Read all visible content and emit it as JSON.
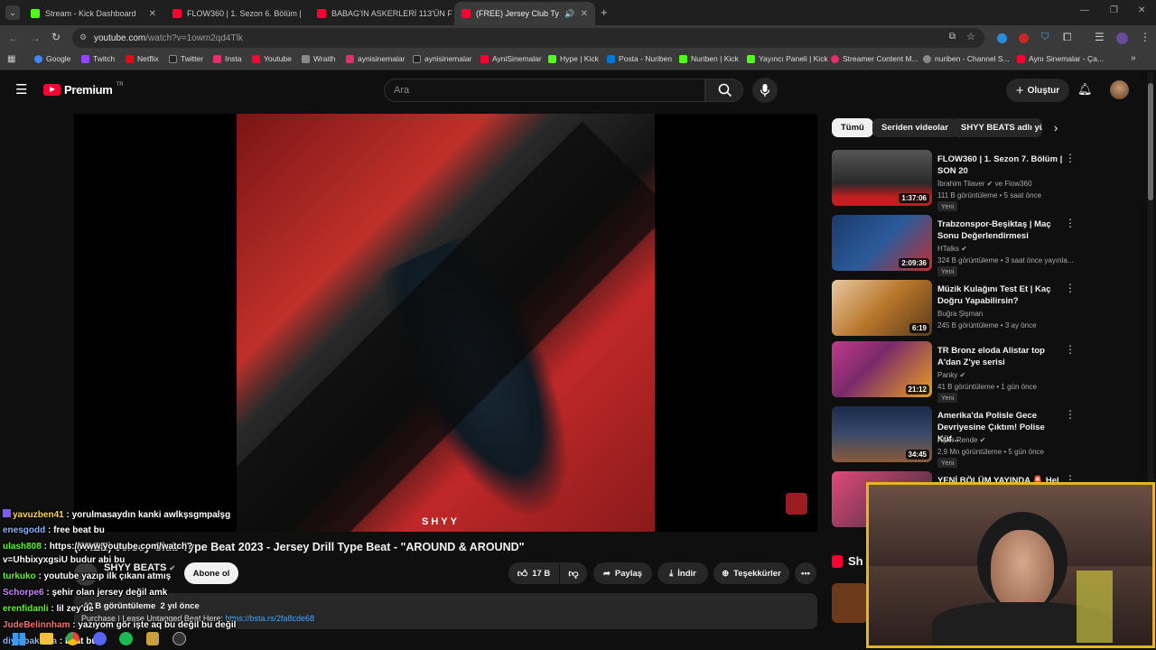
{
  "browser": {
    "tabs": [
      {
        "label": "Stream - Kick Dashboard",
        "favicon_color": "#53fc18"
      },
      {
        "label": "FLOW360 | 1. Sezon 6. Bölüm |",
        "favicon_color": "#ff0033"
      },
      {
        "label": "BABAG'IN ASKERLERİ 113'ÜN F",
        "favicon_color": "#ff0033"
      },
      {
        "label": "(FREE) Jersey Club Type Beat",
        "favicon_color": "#ff0033"
      }
    ],
    "new_tab": "+",
    "url_host": "youtube.com",
    "url_path": "/watch?v=1owm2qd4Tlk",
    "bookmarks": [
      {
        "label": "Google",
        "color": "#4285f4"
      },
      {
        "label": "Twitch",
        "color": "#9146ff"
      },
      {
        "label": "Netflix",
        "color": "#e50914"
      },
      {
        "label": "Twitter",
        "color": "#222222"
      },
      {
        "label": "Insta",
        "color": "#e1306c"
      },
      {
        "label": "Youtube",
        "color": "#ff0033"
      },
      {
        "label": "Wraith",
        "color": "#888888"
      },
      {
        "label": "aynisinemalar",
        "color": "#e1306c"
      },
      {
        "label": "aynisinemalar",
        "color": "#222222"
      },
      {
        "label": "AyniSinemalar",
        "color": "#ff0033"
      },
      {
        "label": "Hype | Kick",
        "color": "#53fc18"
      },
      {
        "label": "Posta - Nuriben",
        "color": "#0078d4"
      },
      {
        "label": "Nuriben | Kick",
        "color": "#53fc18"
      },
      {
        "label": "Yayıncı Paneli | Kick",
        "color": "#53fc18"
      },
      {
        "label": "Streamer Content M...",
        "color": "#e1306c"
      },
      {
        "label": "nuriben - Channel S...",
        "color": "#888888"
      },
      {
        "label": "Aynı Sinemalar - Ça...",
        "color": "#ff0033"
      }
    ]
  },
  "youtube": {
    "logo": "Premium",
    "logo_sup": "TR",
    "search_placeholder": "Ara",
    "create_label": "Oluştur",
    "chips": [
      "Tümü",
      "Seriden videolar",
      "SHYY BEATS adlı yük"
    ],
    "video": {
      "watermark": "SHYY",
      "title": "(FREE) Jersey Club Type Beat 2023 - Jersey Drill Type Beat - \"AROUND & AROUND\"",
      "channel": "SHYY BEATS",
      "subscribe": "Abone ol",
      "likes": "17 B",
      "share": "Paylaş",
      "download": "İndir",
      "thanks": "Teşekkürler",
      "views": "40 B görüntüleme",
      "age": "2 yıl önce",
      "desc_prefix": "Purchase | Lease Untagged Beat Here: ",
      "desc_link": "https://bsta.rs/2fa8cde68"
    },
    "recommendations": [
      {
        "title": "FLOW360 | 1. Sezon 7. Bölüm | SON 20",
        "channel": "İbrahim Tilaver ✔ ve Flow360",
        "meta": "111 B görüntüleme • 5 saat önce",
        "badge": "Yeni",
        "duration": "1:37:06",
        "thumb_color": "#3a3a3a"
      },
      {
        "title": "Trabzonspor-Beşiktaş | Maç Sonu Değerlendirmesi",
        "channel": "HTalks ✔",
        "meta": "324 B görüntüleme • 3 saat önce yayınla...",
        "badge": "Yeni",
        "duration": "2:09:36",
        "thumb_color": "#1c3a6a"
      },
      {
        "title": "Müzik Kulağını Test Et | Kaç Doğru Yapabilirsin?",
        "channel": "Buğra Şişman",
        "meta": "245 B görüntüleme • 3 ay önce",
        "badge": "",
        "duration": "6:19",
        "thumb_color": "#b8752a"
      },
      {
        "title": "TR Bronz eloda Alistar top A'dan Z'ye serisi",
        "channel": "Panky ✔",
        "meta": "41 B görüntüleme • 1 gün önce",
        "badge": "Yeni",
        "duration": "21:12",
        "thumb_color": "#7a2a6a"
      },
      {
        "title": "Amerika'da Polisle Gece Devriyesine Çıktım! Polise Küf...",
        "channel": "Alper Rende ✔",
        "meta": "2,9 Mn görüntüleme • 5 gün önce",
        "badge": "Yeni",
        "duration": "34:45",
        "thumb_color": "#2a3a5a"
      },
      {
        "title": "YENİ BÖLÜM YAYINDA 🚨 Helin",
        "channel": "",
        "meta": "",
        "badge": "",
        "duration": "",
        "thumb_color": "#8a3a5a"
      }
    ],
    "shorts_label": "Sh"
  },
  "chat": [
    {
      "user": "yavuzben41",
      "msg": " : yorulmasaydın kanki awlkşsgmpalşg",
      "color": "#ffd54a"
    },
    {
      "user": "enesgodd",
      "msg": " : free beat bu",
      "color": "#8ab4f8"
    },
    {
      "user": "ulash808",
      "msg": " : https://www.youtube.com/watch?",
      "color": "#53fc18"
    },
    {
      "user": "",
      "msg": "v=UhbixyxgsiU budur abi bu",
      "color": "#ffffff"
    },
    {
      "user": "turkuko",
      "msg": " : youtube yazıp ilk çıkanı atmış",
      "color": "#53fc18"
    },
    {
      "user": "Schorpe6",
      "msg": " : şehir olan jersey değil amk",
      "color": "#c58af9"
    },
    {
      "user": "erenfidanli",
      "msg": " : lil zey'de",
      "color": "#53fc18"
    },
    {
      "user": "JudeBelinnham",
      "msg": " : yazıyom gör işte aq bu değil bu değil",
      "color": "#ff6b6b"
    },
    {
      "user": "diyetbaklava",
      "msg": " : beat bu",
      "color": "#8ab4f8"
    }
  ]
}
